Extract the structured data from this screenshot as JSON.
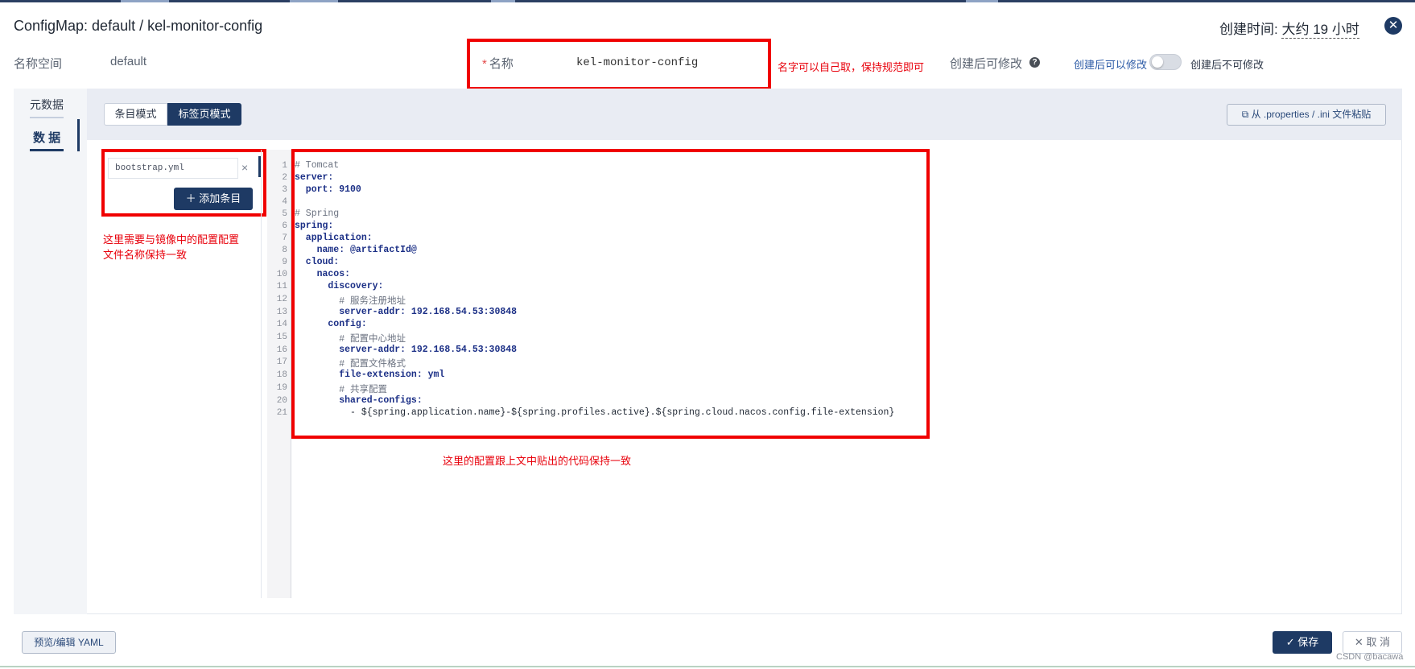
{
  "header": {
    "title": "ConfigMap: default / kel-monitor-config",
    "created_label": "创建时间:",
    "created_value": "大约 19 小时"
  },
  "meta": {
    "namespace_label": "名称空间",
    "namespace_value": "default",
    "name_required_mark": "*",
    "name_label": "名称",
    "name_value": "kel-monitor-config",
    "modifiable_label": "创建后可修改",
    "modifiable_yes": "创建后可以修改",
    "modifiable_no": "创建后不可修改",
    "modifiable_enabled": false
  },
  "annotations": {
    "name_note": "名字可以自己取，保持规范即可",
    "key_note_line1": "这里需要与镜像中的配置配置",
    "key_note_line2": "文件名称保持一致",
    "code_note": "这里的配置跟上文中贴出的代码保持一致"
  },
  "sidenav": {
    "items": [
      {
        "label": "元数据"
      },
      {
        "label": "数 据"
      }
    ]
  },
  "toolbar": {
    "mode_entry": "条目模式",
    "mode_tab": "标签页模式",
    "paste_button": "从 .properties / .ini 文件粘贴"
  },
  "entry": {
    "key_value": "bootstrap.yml",
    "add_button": "添加条目"
  },
  "editor": {
    "line_numbers": [
      "1",
      "2",
      "3",
      "4",
      "5",
      "6",
      "7",
      "8",
      "9",
      "10",
      "11",
      "12",
      "13",
      "14",
      "15",
      "16",
      "17",
      "18",
      "19",
      "20",
      "21"
    ],
    "lines": [
      "# Tomcat",
      "server:",
      "  port: 9100",
      "",
      "# Spring",
      "spring:",
      "  application:",
      "    name: @artifactId@",
      "  cloud:",
      "    nacos:",
      "      discovery:",
      "        # 服务注册地址",
      "        server-addr: 192.168.54.53:30848",
      "      config:",
      "        # 配置中心地址",
      "        server-addr: 192.168.54.53:30848",
      "        # 配置文件格式",
      "        file-extension: yml",
      "        # 共享配置",
      "        shared-configs:",
      "          - ${spring.application.name}-${spring.profiles.active}.${spring.cloud.nacos.config.file-extension}"
    ]
  },
  "footer": {
    "yaml_button": "预览/编辑 YAML",
    "save_button": "保存",
    "cancel_button": "取 消",
    "watermark": "CSDN @bacawa"
  },
  "colors": {
    "primary": "#1e3a64",
    "annotation_red": "#f00000"
  }
}
